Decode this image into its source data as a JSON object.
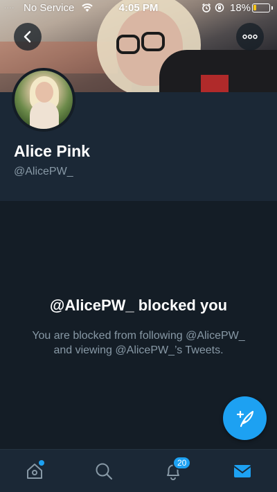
{
  "status_bar": {
    "signal": "....",
    "carrier": "No Service",
    "time": "4:05 PM",
    "battery_percent": "18%",
    "battery_level": 0.18,
    "battery_color": "#f5c518"
  },
  "header": {
    "back_icon": "chevron-left-icon",
    "more_icon": "more-horizontal-icon"
  },
  "profile": {
    "display_name": "Alice Pink",
    "handle": "@AlicePW_"
  },
  "blocked": {
    "title": "@AlicePW_ blocked you",
    "description": "You are blocked from following @AlicePW_ and viewing @AlicePW_’s Tweets."
  },
  "compose": {
    "icon": "compose-tweet-icon"
  },
  "tab_bar": {
    "items": [
      {
        "icon": "home-icon",
        "has_dot": true
      },
      {
        "icon": "search-icon"
      },
      {
        "icon": "notifications-icon",
        "badge": "20"
      },
      {
        "icon": "messages-icon",
        "active": true
      }
    ]
  },
  "colors": {
    "accent": "#1da1f2",
    "background": "#141d26",
    "card": "#1b2836",
    "secondary_text": "#8899a6"
  }
}
